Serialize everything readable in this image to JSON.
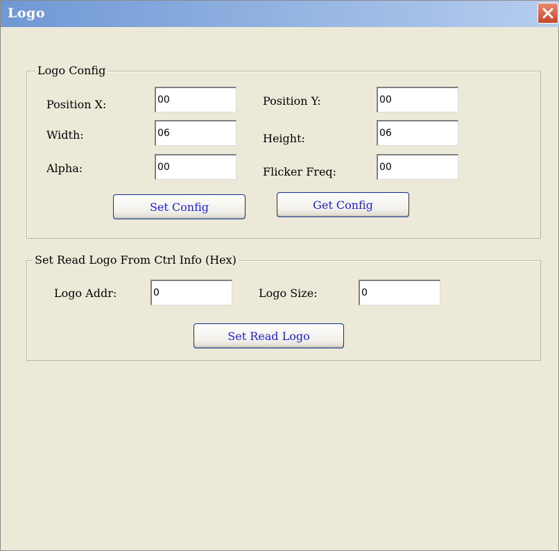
{
  "window": {
    "title": "Logo"
  },
  "logo_config": {
    "legend": "Logo Config",
    "position_x": {
      "label": "Position X:",
      "value": "00"
    },
    "position_y": {
      "label": "Position Y:",
      "value": "00"
    },
    "width": {
      "label": "Width:",
      "value": "06"
    },
    "height": {
      "label": "Height:",
      "value": "06"
    },
    "alpha": {
      "label": "Alpha:",
      "value": "00"
    },
    "flicker_freq": {
      "label": "Flicker Freq:",
      "value": "00"
    },
    "set_button": "Set Config",
    "get_button": "Get Config"
  },
  "read_logo": {
    "legend": "Set Read Logo From Ctrl Info (Hex)",
    "logo_addr": {
      "label": "Logo Addr:",
      "value": "0"
    },
    "logo_size": {
      "label": "Logo Size:",
      "value": "0"
    },
    "set_button": "Set Read Logo"
  },
  "icons": {
    "close": "close-icon"
  },
  "colors": {
    "titlebar": "#6f98d4",
    "dialog_bg": "#ece9d8",
    "button_text": "#1d1dd8",
    "close": "#c6462b"
  }
}
